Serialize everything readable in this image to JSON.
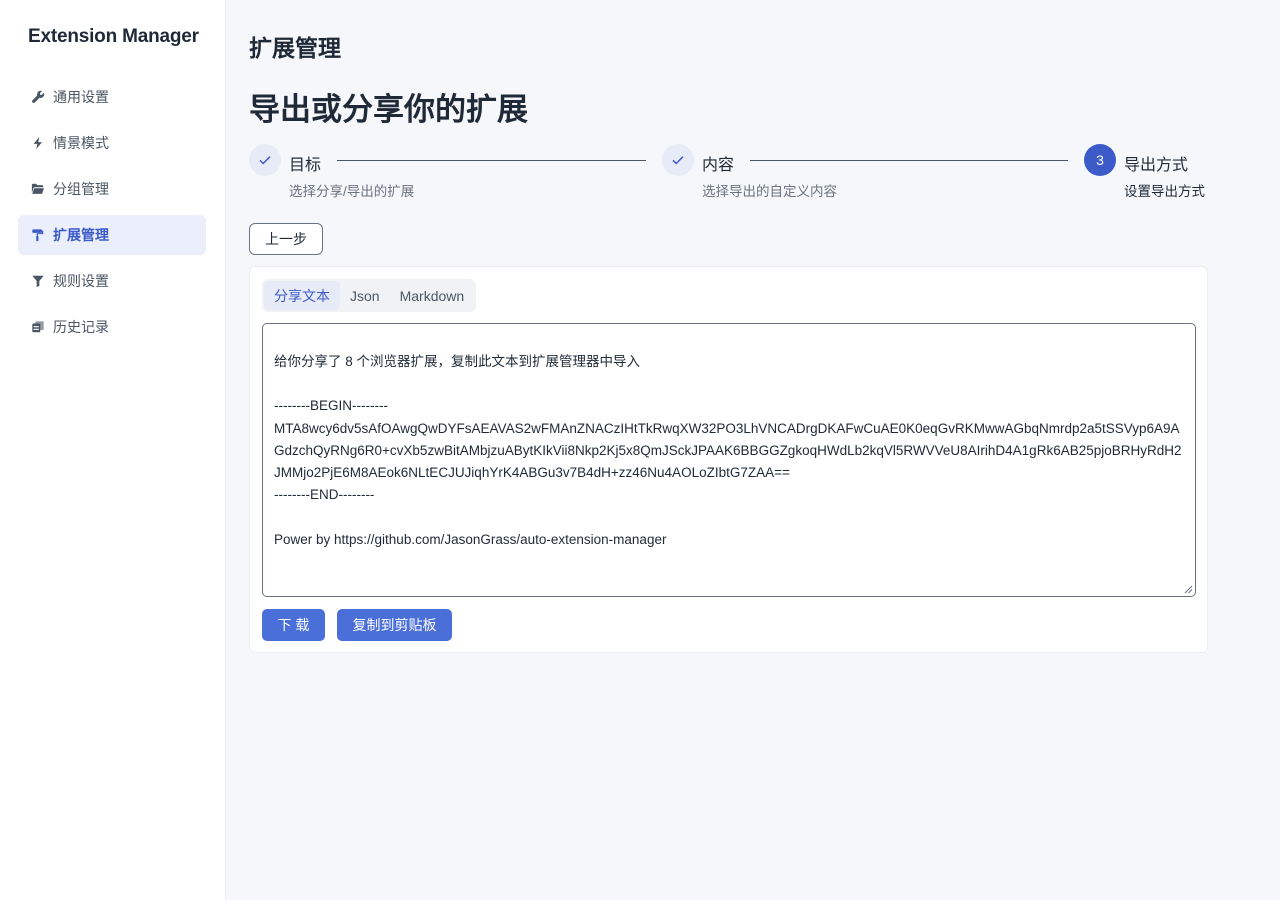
{
  "app": {
    "title": "Extension Manager"
  },
  "sidebar": {
    "items": [
      {
        "label": "通用设置",
        "icon": "wrench-icon"
      },
      {
        "label": "情景模式",
        "icon": "bolt-icon"
      },
      {
        "label": "分组管理",
        "icon": "folder-open-icon"
      },
      {
        "label": "扩展管理",
        "icon": "paint-roller-icon",
        "active": true
      },
      {
        "label": "规则设置",
        "icon": "filter-icon"
      },
      {
        "label": "历史记录",
        "icon": "history-icon"
      }
    ]
  },
  "page": {
    "title": "扩展管理",
    "heading": "导出或分享你的扩展"
  },
  "steps": [
    {
      "title": "目标",
      "description": "选择分享/导出的扩展",
      "status": "done"
    },
    {
      "title": "内容",
      "description": "选择导出的自定义内容",
      "status": "done"
    },
    {
      "number": "3",
      "title": "导出方式",
      "description": "设置导出方式",
      "status": "current"
    }
  ],
  "prev_button": "上一步",
  "tabs": [
    {
      "label": "分享文本",
      "active": true
    },
    {
      "label": "Json"
    },
    {
      "label": "Markdown"
    }
  ],
  "share_text": "给你分享了 8 个浏览器扩展，复制此文本到扩展管理器中导入\n\n--------BEGIN--------\nMTA8wcy6dv5sAfOAwgQwDYFsAEAVAS2wFMAnZNACzIHtTkRwqXW32PO3LhVNCADrgDKAFwCuAE0K0eqGvRKMwwAGbqNmrdp2a5tSSVyp6A9AGdzchQyRNg6R0+cvXb5zwBitAMbjzuABytKIkVii8Nkp2Kj5x8QmJSckJPAAK6BBGGZgkoqHWdLb2kqVl5RWVVeU8AIrihD4A1gRk6AB25pjoBRHyRdH2JMMjo2PjE6M8AEok6NLtECJUJiqhYrK4ABGu3v7B4dH+zz46Nu4AOLoZIbtG7ZAA==\n--------END--------\n\nPower by https://github.com/JasonGrass/auto-extension-manager",
  "actions": {
    "download": "下 载",
    "copy": "复制到剪贴板"
  },
  "colors": {
    "accent": "#3d5bc8",
    "button": "#4b6fd9",
    "active_bg": "#eaeffb"
  }
}
